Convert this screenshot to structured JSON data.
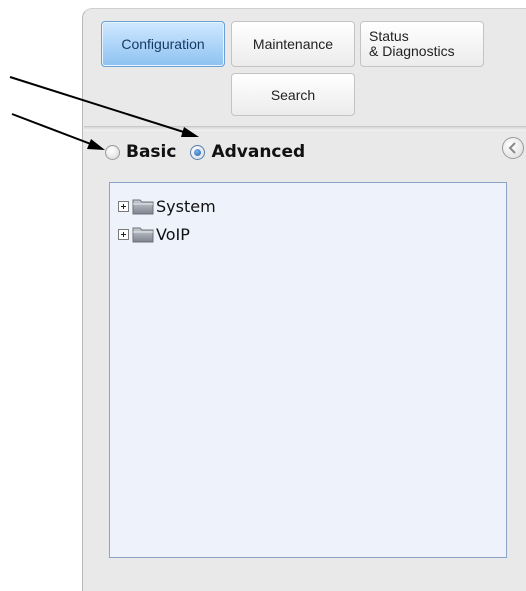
{
  "tabs": {
    "configuration": "Configuration",
    "maintenance": "Maintenance",
    "status_line1": "Status",
    "status_line2": "& Diagnostics",
    "search": "Search"
  },
  "mode": {
    "basic_label": "Basic",
    "advanced_label": "Advanced",
    "selected": "Advanced"
  },
  "tree": {
    "items": [
      {
        "label": "System",
        "icon": "folder-icon",
        "expander": "plus"
      },
      {
        "label": "VoIP",
        "icon": "folder-icon",
        "expander": "plus"
      }
    ]
  },
  "colors": {
    "active_tab": "#8ec2f1",
    "tree_bg": "#eef3fb",
    "tree_border": "#8ba3c7",
    "panel_bg": "#e9e9e9"
  }
}
